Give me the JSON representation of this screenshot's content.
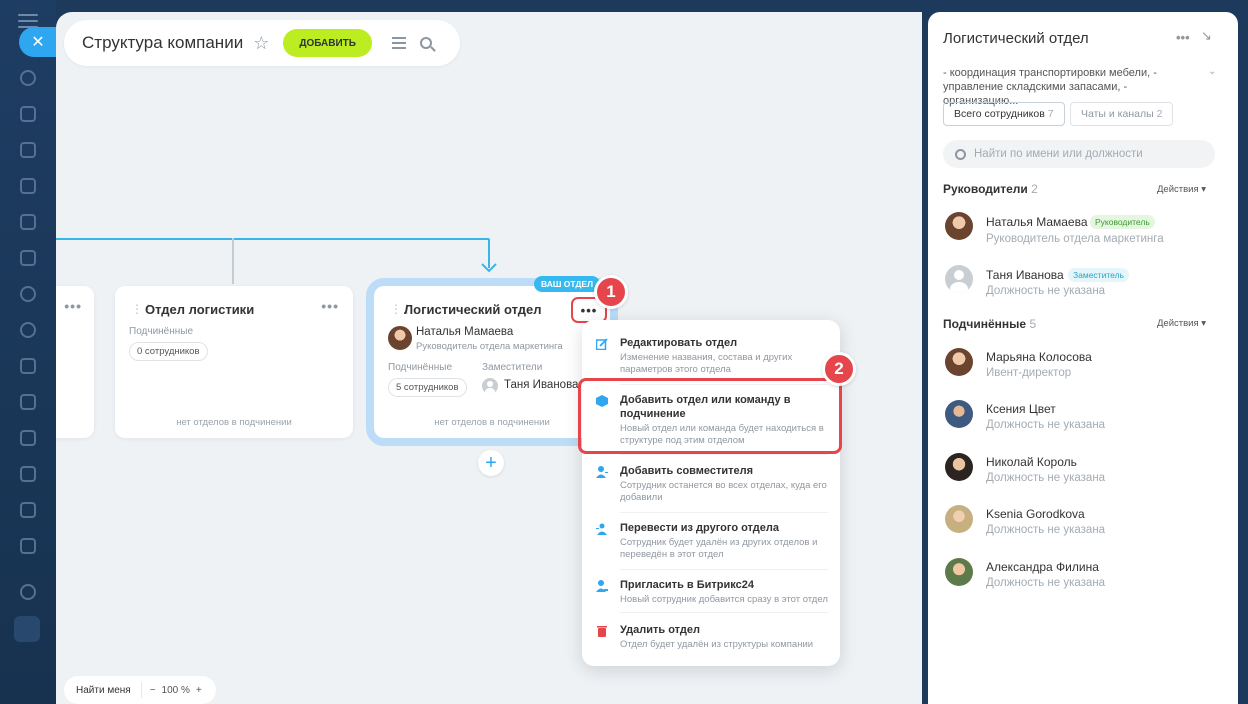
{
  "canvas": {
    "title": "Структура компании",
    "add_button": "ДОБАВИТЬ",
    "find_me": "Найти меня",
    "zoom": "100 %",
    "zoom_minus": "−",
    "zoom_plus": "+"
  },
  "cards": {
    "left_partial": {
      "dots": "•••"
    },
    "logistics": {
      "title": "Отдел логистики",
      "subordinates_label": "Подчинённые",
      "subordinates_count": "0 сотрудников",
      "footer": "нет отделов в подчинении"
    },
    "logistic_dept": {
      "badge": "ВАШ ОТДЕЛ",
      "title": "Логистический отдел",
      "head_name": "Наталья Мамаева",
      "head_role": "Руководитель отдела маркетинга",
      "subordinates_label": "Подчинённые",
      "subordinates_count": "5 сотрудников",
      "deputies_label": "Заместители",
      "deputy_name": "Таня Иванова",
      "footer": "нет отделов в подчинении"
    }
  },
  "steps": [
    "1",
    "2"
  ],
  "menu": [
    {
      "title": "Редактировать отдел",
      "desc": "Изменение названия, состава и других параметров этого отдела",
      "icon": "edit-icon",
      "color": "#2fa6f0"
    },
    {
      "title": "Добавить отдел или команду в подчинение",
      "desc": "Новый отдел или команда будет находиться в структуре под этим отделом",
      "icon": "cube-icon",
      "color": "#2fa6f0"
    },
    {
      "title": "Добавить совместителя",
      "desc": "Сотрудник останется во всех отделах, куда его добавили",
      "icon": "person-add-icon",
      "color": "#2fa6f0"
    },
    {
      "title": "Перевести из другого отдела",
      "desc": "Сотрудник будет удалён из других отделов и переведён в этот отдел",
      "icon": "transfer-icon",
      "color": "#2fa6f0"
    },
    {
      "title": "Пригласить в Битрикс24",
      "desc": "Новый сотрудник добавится сразу в этот отдел",
      "icon": "invite-icon",
      "color": "#2fa6f0"
    },
    {
      "title": "Удалить отдел",
      "desc": "Отдел будет удалён из структуры компании",
      "icon": "trash-icon",
      "color": "#e5454b"
    }
  ],
  "panel": {
    "title": "Логистический отдел",
    "description": "- координация транспортировки мебели, - управление складскими запасами, - организацию...",
    "tab_employees": "Всего сотрудников",
    "tab_employees_count": "7",
    "tab_chats": "Чаты и каналы",
    "tab_chats_count": "2",
    "search_placeholder": "Найти по имени или должности",
    "heads_label": "Руководители",
    "heads_count": "2",
    "subs_label": "Подчинённые",
    "subs_count": "5",
    "actions_label": "Действия",
    "heads": [
      {
        "name": "Наталья Мамаева",
        "tag": "Руководитель",
        "role": "Руководитель отдела маркетинга"
      },
      {
        "name": "Таня Иванова",
        "tag": "Заместитель",
        "role": "Должность не указана"
      }
    ],
    "subs": [
      {
        "name": "Марьяна Колосова",
        "role": "Ивент-директор"
      },
      {
        "name": "Ксения Цвет",
        "role": "Должность не указана"
      },
      {
        "name": "Николай Король",
        "role": "Должность не указана"
      },
      {
        "name": "Ksenia Gorodkova",
        "role": "Должность не указана"
      },
      {
        "name": "Александра Филина",
        "role": "Должность не указана"
      }
    ]
  }
}
